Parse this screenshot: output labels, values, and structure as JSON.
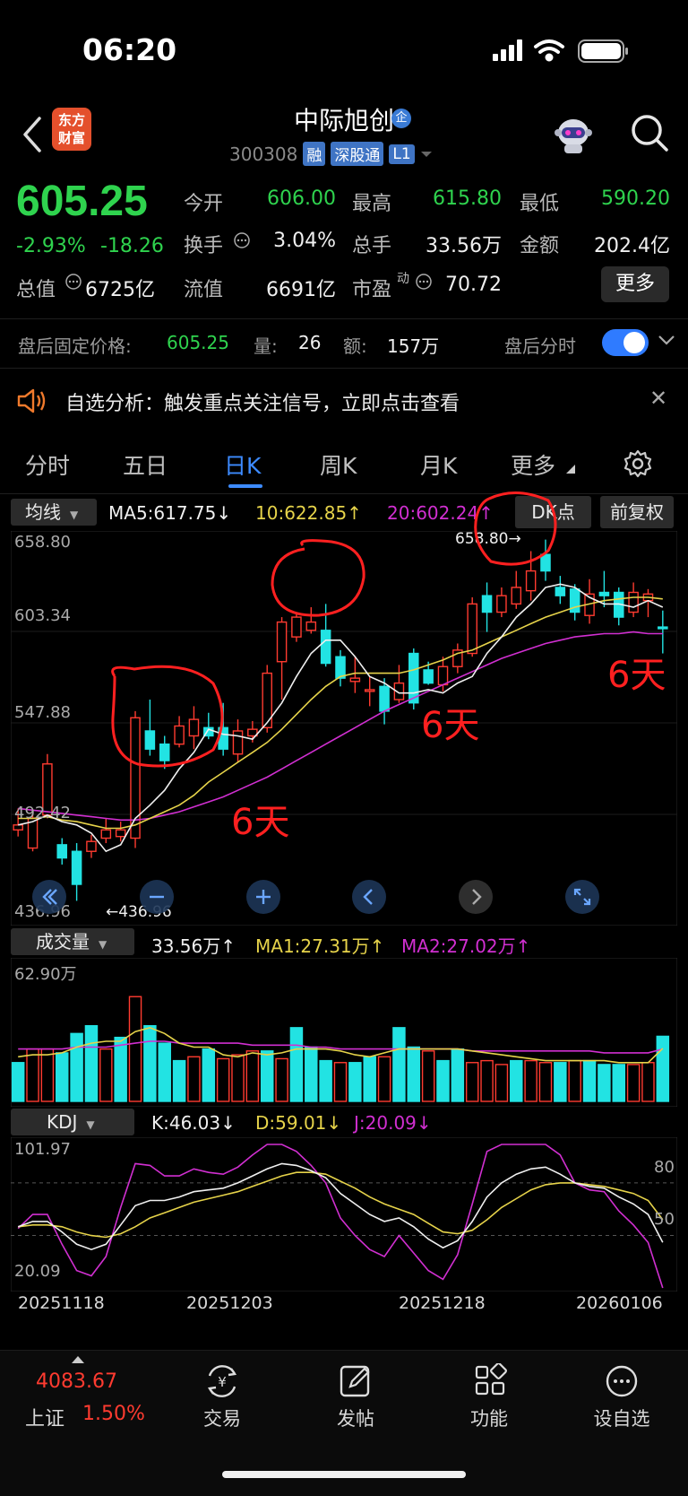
{
  "status_bar": {
    "time": "06:20"
  },
  "header": {
    "title": "中际旭创",
    "badge": "企",
    "code": "300308",
    "tags": [
      "融",
      "深股通",
      "L1"
    ],
    "logo_text": "东方财富"
  },
  "quote": {
    "price": "605.25",
    "change_pct": "-2.93%",
    "change": "-18.26",
    "fields": [
      {
        "label": "今开",
        "value": "606.00",
        "color": "#2fd34e"
      },
      {
        "label": "最高",
        "value": "615.80",
        "color": "#2fd34e"
      },
      {
        "label": "最低",
        "value": "590.20",
        "color": "#2fd34e"
      },
      {
        "label": "换手",
        "value": "3.04%",
        "color": "#f0f0f0"
      },
      {
        "label": "总手",
        "value": "33.56万",
        "color": "#f0f0f0"
      },
      {
        "label": "金额",
        "value": "202.4亿",
        "color": "#f0f0f0"
      },
      {
        "label": "总值",
        "value": "6725亿",
        "color": "#f0f0f0"
      },
      {
        "label": "流值",
        "value": "6691亿",
        "color": "#f0f0f0"
      },
      {
        "label": "市盈",
        "sup": "动",
        "value": "70.72",
        "color": "#f0f0f0"
      }
    ],
    "more_label": "更多"
  },
  "after_hours": {
    "label": "盘后固定价格:",
    "price": "605.25",
    "vol_label": "量:",
    "vol": "26",
    "amt_label": "额:",
    "amt": "157万",
    "timeshare_label": "盘后分时",
    "toggle_on": true
  },
  "alert": {
    "text": "自选分析：触发重点关注信号，立即点击查看"
  },
  "tabs": [
    {
      "label": "分时",
      "active": false
    },
    {
      "label": "五日",
      "active": false
    },
    {
      "label": "日K",
      "active": true
    },
    {
      "label": "周K",
      "active": false
    },
    {
      "label": "月K",
      "active": false
    },
    {
      "label": "更多",
      "active": false
    }
  ],
  "kline_header": {
    "ma_button": "均线",
    "ma5": "MA5:617.75",
    "ma5_arrow": "↓",
    "ma10": "10:622.85",
    "ma10_arrow": "↑",
    "ma20": "20:602.24",
    "ma20_arrow": "↑",
    "dk_button": "DK点",
    "adjust_button": "前复权",
    "colors": {
      "ma5": "#f0f0f0",
      "ma10": "#e6d34a",
      "ma20": "#d12fd1"
    }
  },
  "kline_axis": {
    "y_labels": [
      "658.80",
      "603.34",
      "547.88",
      "492.42",
      "436.96"
    ],
    "high_marker": "658.80→",
    "low_marker": "←436.96"
  },
  "volume_header": {
    "button": "成交量",
    "vol": "33.56万",
    "vol_arrow": "↑",
    "ma1": "MA1:27.31万",
    "ma1_arrow": "↑",
    "ma2": "MA2:27.02万",
    "ma2_arrow": "↑",
    "y_max": "62.90万"
  },
  "kdj_header": {
    "button": "KDJ",
    "k": "K:46.03",
    "k_arrow": "↓",
    "d": "D:59.01",
    "d_arrow": "↓",
    "j": "J:20.09",
    "j_arrow": "↓",
    "y_max": "101.97",
    "y_min": "20.09",
    "ref_80": "80",
    "ref_50": "50"
  },
  "x_dates": [
    "20251118",
    "20251203",
    "20251218",
    "20260106"
  ],
  "annotations": [
    "6天",
    "6天",
    "6天"
  ],
  "chart_data": [
    {
      "type": "candlestick",
      "title": "",
      "ylim": [
        436.96,
        658.8
      ],
      "candles": [
        {
          "o": 483,
          "c": 486,
          "h": 496,
          "l": 479
        },
        {
          "o": 472,
          "c": 490,
          "h": 495,
          "l": 470
        },
        {
          "o": 492,
          "c": 523,
          "h": 529,
          "l": 490
        },
        {
          "o": 474,
          "c": 466,
          "h": 478,
          "l": 462
        },
        {
          "o": 470,
          "c": 450,
          "h": 475,
          "l": 440
        },
        {
          "o": 470,
          "c": 476,
          "h": 480,
          "l": 466
        },
        {
          "o": 478,
          "c": 483,
          "h": 490,
          "l": 475
        },
        {
          "o": 479,
          "c": 483,
          "h": 488,
          "l": 476
        },
        {
          "o": 478,
          "c": 551,
          "h": 555,
          "l": 472
        },
        {
          "o": 543,
          "c": 532,
          "h": 562,
          "l": 528
        },
        {
          "o": 535,
          "c": 525,
          "h": 540,
          "l": 520
        },
        {
          "o": 535,
          "c": 546,
          "h": 552,
          "l": 533
        },
        {
          "o": 540,
          "c": 550,
          "h": 558,
          "l": 532
        },
        {
          "o": 545,
          "c": 540,
          "h": 554,
          "l": 538
        },
        {
          "o": 545,
          "c": 532,
          "h": 560,
          "l": 528
        },
        {
          "o": 529,
          "c": 543,
          "h": 550,
          "l": 524
        },
        {
          "o": 540,
          "c": 544,
          "h": 549,
          "l": 536
        },
        {
          "o": 545,
          "c": 578,
          "h": 583,
          "l": 542
        },
        {
          "o": 585,
          "c": 609,
          "h": 612,
          "l": 562
        },
        {
          "o": 600,
          "c": 612,
          "h": 615,
          "l": 597
        },
        {
          "o": 604,
          "c": 609,
          "h": 618,
          "l": 602
        },
        {
          "o": 604,
          "c": 584,
          "h": 620,
          "l": 582
        },
        {
          "o": 588,
          "c": 575,
          "h": 592,
          "l": 570
        },
        {
          "o": 573,
          "c": 575,
          "h": 588,
          "l": 566
        },
        {
          "o": 567,
          "c": 568,
          "h": 576,
          "l": 558
        },
        {
          "o": 570,
          "c": 555,
          "h": 575,
          "l": 547
        },
        {
          "o": 562,
          "c": 572,
          "h": 583,
          "l": 560
        },
        {
          "o": 590,
          "c": 560,
          "h": 593,
          "l": 556
        },
        {
          "o": 580,
          "c": 572,
          "h": 585,
          "l": 571
        },
        {
          "o": 571,
          "c": 582,
          "h": 588,
          "l": 567
        },
        {
          "o": 582,
          "c": 592,
          "h": 596,
          "l": 578
        },
        {
          "o": 590,
          "c": 620,
          "h": 624,
          "l": 588
        },
        {
          "o": 625,
          "c": 615,
          "h": 633,
          "l": 603
        },
        {
          "o": 615,
          "c": 625,
          "h": 630,
          "l": 612
        },
        {
          "o": 620,
          "c": 630,
          "h": 640,
          "l": 617
        },
        {
          "o": 628,
          "c": 640,
          "h": 652,
          "l": 622
        },
        {
          "o": 650,
          "c": 640,
          "h": 659,
          "l": 634
        },
        {
          "o": 630,
          "c": 625,
          "h": 637,
          "l": 620
        },
        {
          "o": 629,
          "c": 615,
          "h": 632,
          "l": 610
        },
        {
          "o": 613,
          "c": 626,
          "h": 635,
          "l": 608
        },
        {
          "o": 627,
          "c": 625,
          "h": 640,
          "l": 618
        },
        {
          "o": 627,
          "c": 612,
          "h": 630,
          "l": 607
        },
        {
          "o": 615,
          "c": 627,
          "h": 633,
          "l": 612
        },
        {
          "o": 622,
          "c": 626,
          "h": 629,
          "l": 612
        },
        {
          "o": 606,
          "c": 605,
          "h": 616,
          "l": 590
        }
      ],
      "ma5": [
        486,
        488,
        492,
        488,
        486,
        481,
        470,
        474,
        490,
        498,
        507,
        520,
        530,
        544,
        541,
        540,
        538,
        548,
        560,
        576,
        590,
        598,
        598,
        588,
        576,
        572,
        566,
        566,
        568,
        566,
        572,
        576,
        590,
        600,
        612,
        620,
        630,
        632,
        630,
        624,
        620,
        620,
        618,
        622,
        618
      ],
      "ma10": [
        490,
        490,
        491,
        489,
        488,
        486,
        484,
        484,
        486,
        490,
        494,
        498,
        504,
        512,
        518,
        524,
        530,
        536,
        544,
        553,
        562,
        570,
        576,
        578,
        578,
        578,
        578,
        580,
        583,
        586,
        590,
        592,
        596,
        600,
        604,
        608,
        612,
        615,
        618,
        620,
        622,
        623,
        624,
        624,
        623
      ],
      "ma20": [
        496,
        495,
        494,
        493,
        492,
        491,
        490,
        489,
        489,
        490,
        492,
        494,
        497,
        500,
        503,
        507,
        511,
        515,
        520,
        525,
        530,
        535,
        540,
        545,
        550,
        555,
        559,
        563,
        567,
        571,
        575,
        579,
        583,
        587,
        590,
        593,
        596,
        598,
        600,
        601,
        602,
        602,
        603,
        602,
        602
      ]
    },
    {
      "type": "bar",
      "title": "成交量",
      "ylim": [
        0,
        62.9
      ],
      "values": [
        20,
        27,
        27,
        25,
        35,
        39,
        27,
        33,
        54,
        39,
        30,
        21,
        23,
        27,
        22,
        24,
        26,
        26,
        22,
        38,
        28,
        21,
        20,
        20,
        23,
        23,
        38,
        28,
        26,
        21,
        27,
        20,
        21,
        19,
        21,
        21,
        20,
        20,
        21,
        21,
        19,
        19,
        19,
        20,
        33.56
      ],
      "up": [
        false,
        true,
        true,
        false,
        false,
        false,
        true,
        false,
        true,
        false,
        false,
        false,
        true,
        false,
        true,
        true,
        true,
        false,
        true,
        false,
        false,
        false,
        true,
        false,
        false,
        true,
        false,
        false,
        true,
        false,
        false,
        true,
        true,
        true,
        false,
        true,
        true,
        false,
        true,
        false,
        false,
        false,
        true,
        true,
        false
      ],
      "ma1": [
        23,
        24,
        24,
        25,
        28,
        30,
        31,
        31,
        36,
        38,
        35,
        30,
        28,
        28,
        24,
        23,
        25,
        24,
        25,
        27,
        27,
        27,
        26,
        24,
        23,
        25,
        27,
        27,
        27,
        27,
        27,
        26,
        25,
        24,
        23,
        22,
        21,
        21,
        21,
        21,
        21,
        20,
        20,
        20,
        27.31
      ],
      "ma2": [
        27,
        27,
        27,
        27,
        28,
        28,
        28,
        29,
        30,
        31,
        31,
        30,
        30,
        30,
        30,
        30,
        29,
        29,
        29,
        29,
        28,
        28,
        27,
        27,
        27,
        27,
        27,
        27,
        27,
        27,
        27,
        26,
        26,
        26,
        26,
        26,
        26,
        26,
        26,
        26,
        25,
        25,
        25,
        25,
        27.02
      ]
    },
    {
      "type": "line",
      "title": "KDJ",
      "ylim": [
        20.09,
        101.97
      ],
      "k": [
        55,
        58,
        58,
        52,
        45,
        42,
        45,
        56,
        67,
        70,
        70,
        72,
        75,
        76,
        77,
        80,
        84,
        88,
        91,
        90,
        87,
        83,
        74,
        68,
        62,
        58,
        60,
        55,
        48,
        43,
        47,
        58,
        72,
        80,
        85,
        88,
        89,
        85,
        80,
        78,
        77,
        72,
        68,
        62,
        46.03
      ],
      "d": [
        55,
        56,
        56,
        55,
        52,
        50,
        49,
        51,
        55,
        60,
        63,
        66,
        69,
        71,
        73,
        75,
        78,
        81,
        84,
        86,
        86,
        85,
        81,
        77,
        72,
        68,
        65,
        62,
        57,
        52,
        51,
        53,
        59,
        66,
        71,
        76,
        79,
        80,
        80,
        79,
        78,
        76,
        74,
        70,
        59.01
      ],
      "j": [
        54,
        62,
        62,
        45,
        30,
        27,
        38,
        66,
        91,
        90,
        84,
        84,
        88,
        86,
        85,
        89,
        96,
        102,
        102,
        98,
        90,
        80,
        60,
        50,
        42,
        38,
        50,
        40,
        30,
        25,
        39,
        68,
        98,
        108,
        112,
        112,
        108,
        96,
        80,
        76,
        75,
        64,
        56,
        46,
        20.09
      ]
    }
  ],
  "footer": {
    "index_value": "4083.67",
    "index_name": "上证",
    "index_pct": "1.50%",
    "items": [
      {
        "label": "交易",
        "icon": "yen-cycle-icon"
      },
      {
        "label": "发帖",
        "icon": "edit-icon"
      },
      {
        "label": "功能",
        "icon": "grid-icon"
      },
      {
        "label": "设自选",
        "icon": "more-icon"
      }
    ]
  }
}
